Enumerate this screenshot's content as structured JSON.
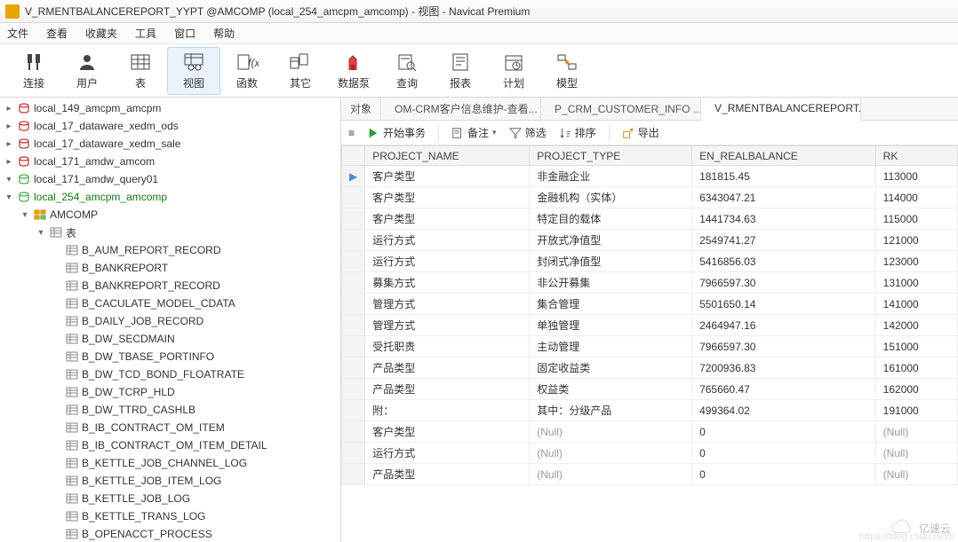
{
  "window": {
    "title": "V_RMENTBALANCEREPORT_YYPT @AMCOMP (local_254_amcpm_amcomp) - 视图 - Navicat Premium"
  },
  "menu": [
    "文件",
    "查看",
    "收藏夹",
    "工具",
    "窗口",
    "帮助"
  ],
  "toolbar": [
    {
      "label": "连接",
      "name": "connect"
    },
    {
      "label": "用户",
      "name": "user"
    },
    {
      "label": "表",
      "name": "table"
    },
    {
      "label": "视图",
      "name": "view",
      "active": true
    },
    {
      "label": "函数",
      "name": "function"
    },
    {
      "label": "其它",
      "name": "other"
    },
    {
      "label": "数据泵",
      "name": "datapump"
    },
    {
      "label": "查询",
      "name": "query"
    },
    {
      "label": "报表",
      "name": "report"
    },
    {
      "label": "计划",
      "name": "schedule"
    },
    {
      "label": "模型",
      "name": "model"
    }
  ],
  "tree": {
    "conns": [
      {
        "name": "local_149_amcpm_amcpm",
        "open": false
      },
      {
        "name": "local_17_dataware_xedm_ods",
        "open": false
      },
      {
        "name": "local_17_dataware_xedm_sale",
        "open": false
      },
      {
        "name": "local_171_amdw_amcom",
        "open": false
      },
      {
        "name": "local_171_amdw_query01",
        "open": true,
        "children": []
      },
      {
        "name": "local_254_amcpm_amcomp",
        "open": true,
        "active": true,
        "schema": {
          "name": "AMCOMP",
          "tablesLabel": "表",
          "tables": [
            "B_AUM_REPORT_RECORD",
            "B_BANKREPORT",
            "B_BANKREPORT_RECORD",
            "B_CACULATE_MODEL_CDATA",
            "B_DAILY_JOB_RECORD",
            "B_DW_SECDMAIN",
            "B_DW_TBASE_PORTINFO",
            "B_DW_TCD_BOND_FLOATRATE",
            "B_DW_TCRP_HLD",
            "B_DW_TTRD_CASHLB",
            "B_IB_CONTRACT_OM_ITEM",
            "B_IB_CONTRACT_OM_ITEM_DETAIL",
            "B_KETTLE_JOB_CHANNEL_LOG",
            "B_KETTLE_JOB_ITEM_LOG",
            "B_KETTLE_JOB_LOG",
            "B_KETTLE_TRANS_LOG",
            "B_OPENACCT_PROCESS"
          ]
        }
      }
    ]
  },
  "tabs": [
    {
      "label": "对象",
      "name": "objects"
    },
    {
      "label": "OM-CRM客户信息维护-查看...",
      "name": "crm-tab"
    },
    {
      "label": "P_CRM_CUSTOMER_INFO ...",
      "name": "pcrm-tab"
    },
    {
      "label": "V_RMENTBALANCEREPORT...",
      "name": "view-tab",
      "active": true,
      "icon": "link"
    }
  ],
  "subbar": {
    "menu": "≡",
    "beginTx": "开始事务",
    "note": "备注",
    "noteArrow": "▾",
    "filter": "筛选",
    "sort": "排序",
    "export": "导出"
  },
  "grid": {
    "cols": [
      "PROJECT_NAME",
      "PROJECT_TYPE",
      "EN_REALBALANCE",
      "RK"
    ],
    "rows": [
      {
        "c": [
          "客户类型",
          "非金融企业",
          "181815.45",
          "113000"
        ],
        "sel": true
      },
      {
        "c": [
          "客户类型",
          "金融机构（实体）",
          "6343047.21",
          "114000"
        ]
      },
      {
        "c": [
          "客户类型",
          "特定目的载体",
          "1441734.63",
          "115000"
        ]
      },
      {
        "c": [
          "运行方式",
          "开放式净值型",
          "2549741.27",
          "121000"
        ]
      },
      {
        "c": [
          "运行方式",
          "封闭式净值型",
          "5416856.03",
          "123000"
        ]
      },
      {
        "c": [
          "募集方式",
          "非公开募集",
          "7966597.30",
          "131000"
        ]
      },
      {
        "c": [
          "管理方式",
          "集合管理",
          "5501650.14",
          "141000"
        ]
      },
      {
        "c": [
          "管理方式",
          "单独管理",
          "2464947.16",
          "142000"
        ]
      },
      {
        "c": [
          "受托职责",
          "主动管理",
          "7966597.30",
          "151000"
        ]
      },
      {
        "c": [
          "产品类型",
          "固定收益类",
          "7200936.83",
          "161000"
        ]
      },
      {
        "c": [
          "产品类型",
          "权益类",
          "765660.47",
          "162000"
        ]
      },
      {
        "c": [
          "附：",
          "其中：分级产品",
          "499364.02",
          "191000"
        ]
      },
      {
        "c": [
          "客户类型",
          "(Null)",
          "0",
          "(Null)"
        ],
        "null": [
          1,
          3
        ]
      },
      {
        "c": [
          "运行方式",
          "(Null)",
          "0",
          "(Null)"
        ],
        "null": [
          1,
          3
        ]
      },
      {
        "c": [
          "产品类型",
          "(Null)",
          "0",
          "(Null)"
        ],
        "null": [
          1,
          3
        ]
      }
    ]
  },
  "watermark": "亿速云"
}
